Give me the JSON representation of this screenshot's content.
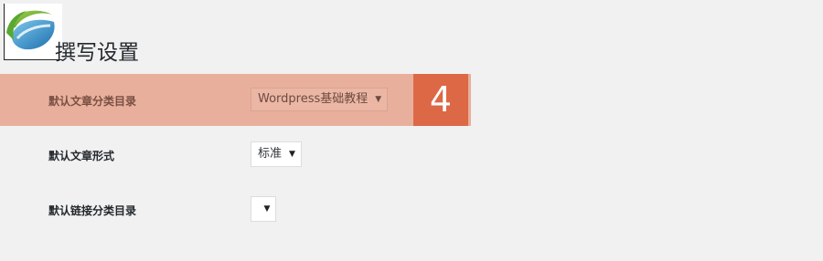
{
  "page": {
    "title": "撰写设置",
    "step_number": "4"
  },
  "rows": [
    {
      "label": "默认文章分类目录",
      "selected": "Wordpress基础教程"
    },
    {
      "label": "默认文章形式",
      "selected": "标准"
    },
    {
      "label": "默认链接分类目录",
      "selected": ""
    }
  ],
  "icons": {
    "logo": "leaf-logo-icon",
    "caret": "caret-down-icon"
  },
  "colors": {
    "background": "#f1f1f1",
    "highlight": "#e8b09c",
    "badge": "#dc6846"
  }
}
